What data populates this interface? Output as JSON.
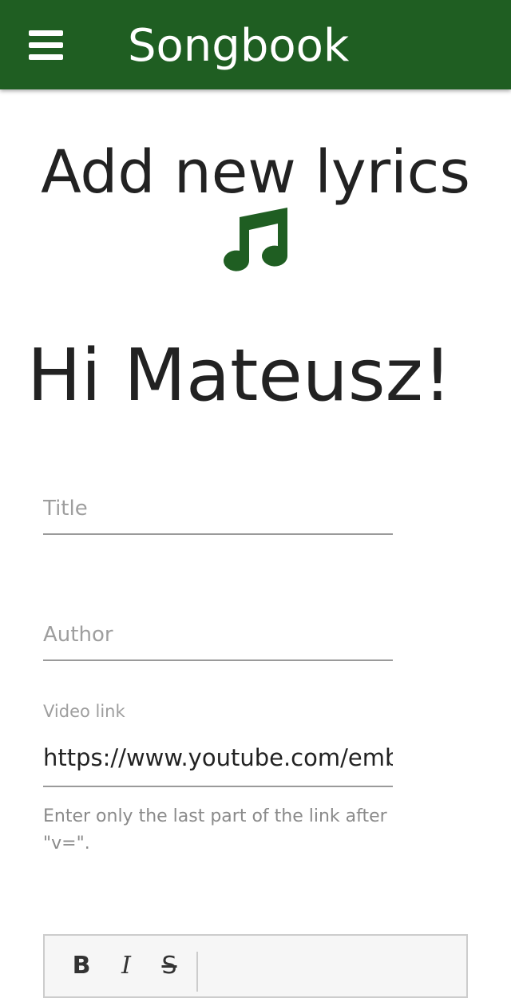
{
  "appbar": {
    "title": "Songbook",
    "menu_icon": "hamburger-menu-icon",
    "background_color": "#1f5e22"
  },
  "main": {
    "heading": "Add new lyrics",
    "heading_icon": "music-note-icon",
    "icon_color": "#1f5e22",
    "greeting": "Hi Mateusz!"
  },
  "form": {
    "title": {
      "placeholder": "Title",
      "value": ""
    },
    "author": {
      "placeholder": "Author",
      "value": ""
    },
    "video": {
      "label": "Video link",
      "value": "https://www.youtube.com/emb",
      "helper": "Enter only the last part of the link after \"v=\"."
    }
  },
  "editor": {
    "toolbar": {
      "bold_label": "B",
      "italic_label": "I",
      "strike_label": "S"
    }
  }
}
